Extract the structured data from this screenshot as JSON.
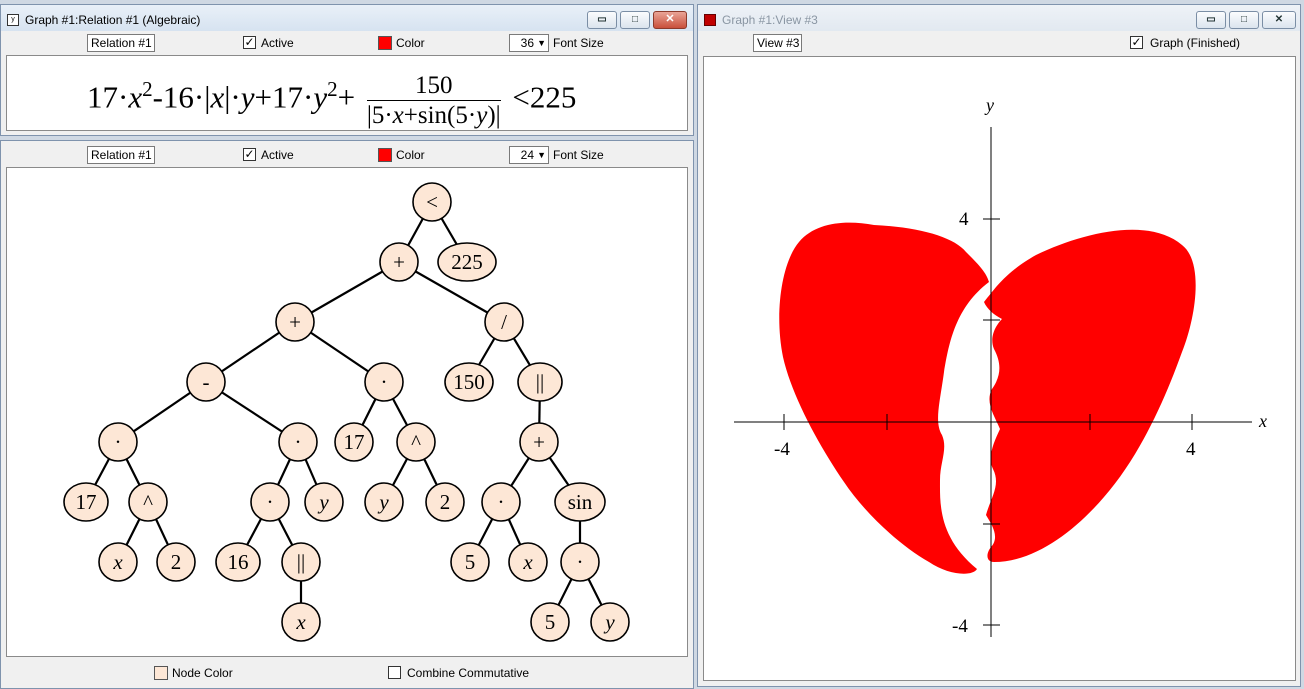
{
  "relation_window": {
    "title": "Graph #1:Relation #1 (Algebraic)",
    "toolbar": {
      "name": "Relation #1",
      "active_label": "Active",
      "active_checked": true,
      "color_label": "Color",
      "color": "#ff0000",
      "font_size": "36",
      "font_size_label": "Font Size"
    },
    "formula": {
      "t1": "17·",
      "x": "x",
      "sq": "2",
      "t2": "-16·|",
      "t3": "|·",
      "t4": "+17·",
      "t5": "+",
      "frac_num": "150",
      "den1": "|5·",
      "den2": "+sin(5·",
      "den3": ")|",
      "rel": "<225"
    }
  },
  "tree_window": {
    "toolbar": {
      "name": "Relation #1",
      "active_label": "Active",
      "active_checked": true,
      "color_label": "Color",
      "color": "#ff0000",
      "font_size": "24",
      "font_size_label": "Font Size"
    },
    "nodes": [
      "<",
      "+",
      "225",
      "+",
      "/",
      "-",
      "·",
      "150",
      "||",
      "·",
      "·",
      "17",
      "^",
      "+",
      "17",
      "^",
      "·",
      "y",
      "y",
      "2",
      "·",
      "sin",
      "x",
      "2",
      "16",
      "||",
      "5",
      "x",
      "·",
      "x",
      "5",
      "y"
    ],
    "footer": {
      "node_color_label": "Node Color",
      "node_color": "#fde7d6",
      "combine_label": "Combine Commutative",
      "combine_checked": false
    }
  },
  "view_window": {
    "title": "Graph #1:View #3",
    "toolbar": {
      "name": "View #3",
      "finished_label": "Graph (Finished)",
      "finished_checked": true
    },
    "axes": {
      "x_label": "x",
      "y_label": "y",
      "x_min_label": "-4",
      "x_max_label": "4",
      "y_max_label": "4",
      "y_min_label": "-4"
    },
    "fill_color": "#ff0000"
  },
  "window_buttons": {
    "minimize": "▭",
    "maximize": "□",
    "close": "✕"
  }
}
